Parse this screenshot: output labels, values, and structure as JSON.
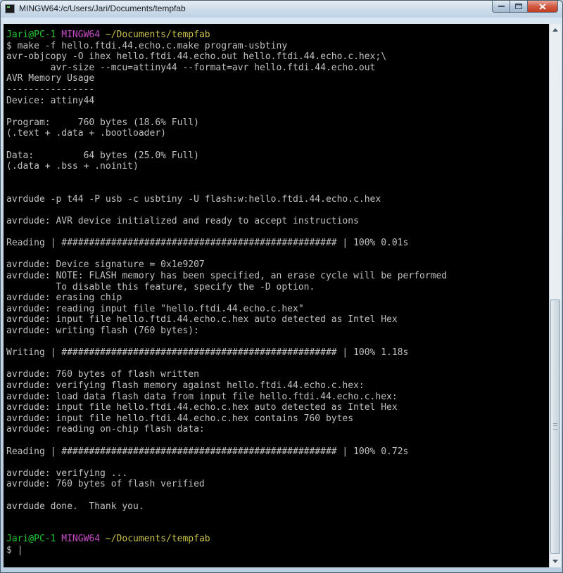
{
  "window": {
    "title": "MINGW64:/c/Users/Jari/Documents/tempfab",
    "buttons": {
      "minimize": "minimize",
      "maximize": "maximize",
      "close": "close"
    }
  },
  "colors": {
    "background": "#000000",
    "text": "#c0c0c0",
    "prompt_user": "#21c832",
    "prompt_env": "#c74bc7",
    "prompt_path": "#c9c24a"
  },
  "prompt": {
    "user": "Jari@PC-1",
    "env": "MINGW64",
    "path": "~/Documents/tempfab"
  },
  "terminal": {
    "lines": [
      "$ make -f hello.ftdi.44.echo.c.make program-usbtiny",
      "avr-objcopy -O ihex hello.ftdi.44.echo.out hello.ftdi.44.echo.c.hex;\\",
      "        avr-size --mcu=attiny44 --format=avr hello.ftdi.44.echo.out",
      "AVR Memory Usage",
      "----------------",
      "Device: attiny44",
      "",
      "Program:     760 bytes (18.6% Full)",
      "(.text + .data + .bootloader)",
      "",
      "Data:         64 bytes (25.0% Full)",
      "(.data + .bss + .noinit)",
      "",
      "",
      "avrdude -p t44 -P usb -c usbtiny -U flash:w:hello.ftdi.44.echo.c.hex",
      "",
      "avrdude: AVR device initialized and ready to accept instructions",
      "",
      "Reading | ################################################## | 100% 0.01s",
      "",
      "avrdude: Device signature = 0x1e9207",
      "avrdude: NOTE: FLASH memory has been specified, an erase cycle will be performed",
      "         To disable this feature, specify the -D option.",
      "avrdude: erasing chip",
      "avrdude: reading input file \"hello.ftdi.44.echo.c.hex\"",
      "avrdude: input file hello.ftdi.44.echo.c.hex auto detected as Intel Hex",
      "avrdude: writing flash (760 bytes):",
      "",
      "Writing | ################################################## | 100% 1.18s",
      "",
      "avrdude: 760 bytes of flash written",
      "avrdude: verifying flash memory against hello.ftdi.44.echo.c.hex:",
      "avrdude: load data flash data from input file hello.ftdi.44.echo.c.hex:",
      "avrdude: input file hello.ftdi.44.echo.c.hex auto detected as Intel Hex",
      "avrdude: input file hello.ftdi.44.echo.c.hex contains 760 bytes",
      "avrdude: reading on-chip flash data:",
      "",
      "Reading | ################################################## | 100% 0.72s",
      "",
      "avrdude: verifying ...",
      "avrdude: 760 bytes of flash verified",
      "",
      "avrdude done.  Thank you.",
      "",
      ""
    ],
    "final_prompt_symbol": "$ ",
    "cursor": "|"
  }
}
